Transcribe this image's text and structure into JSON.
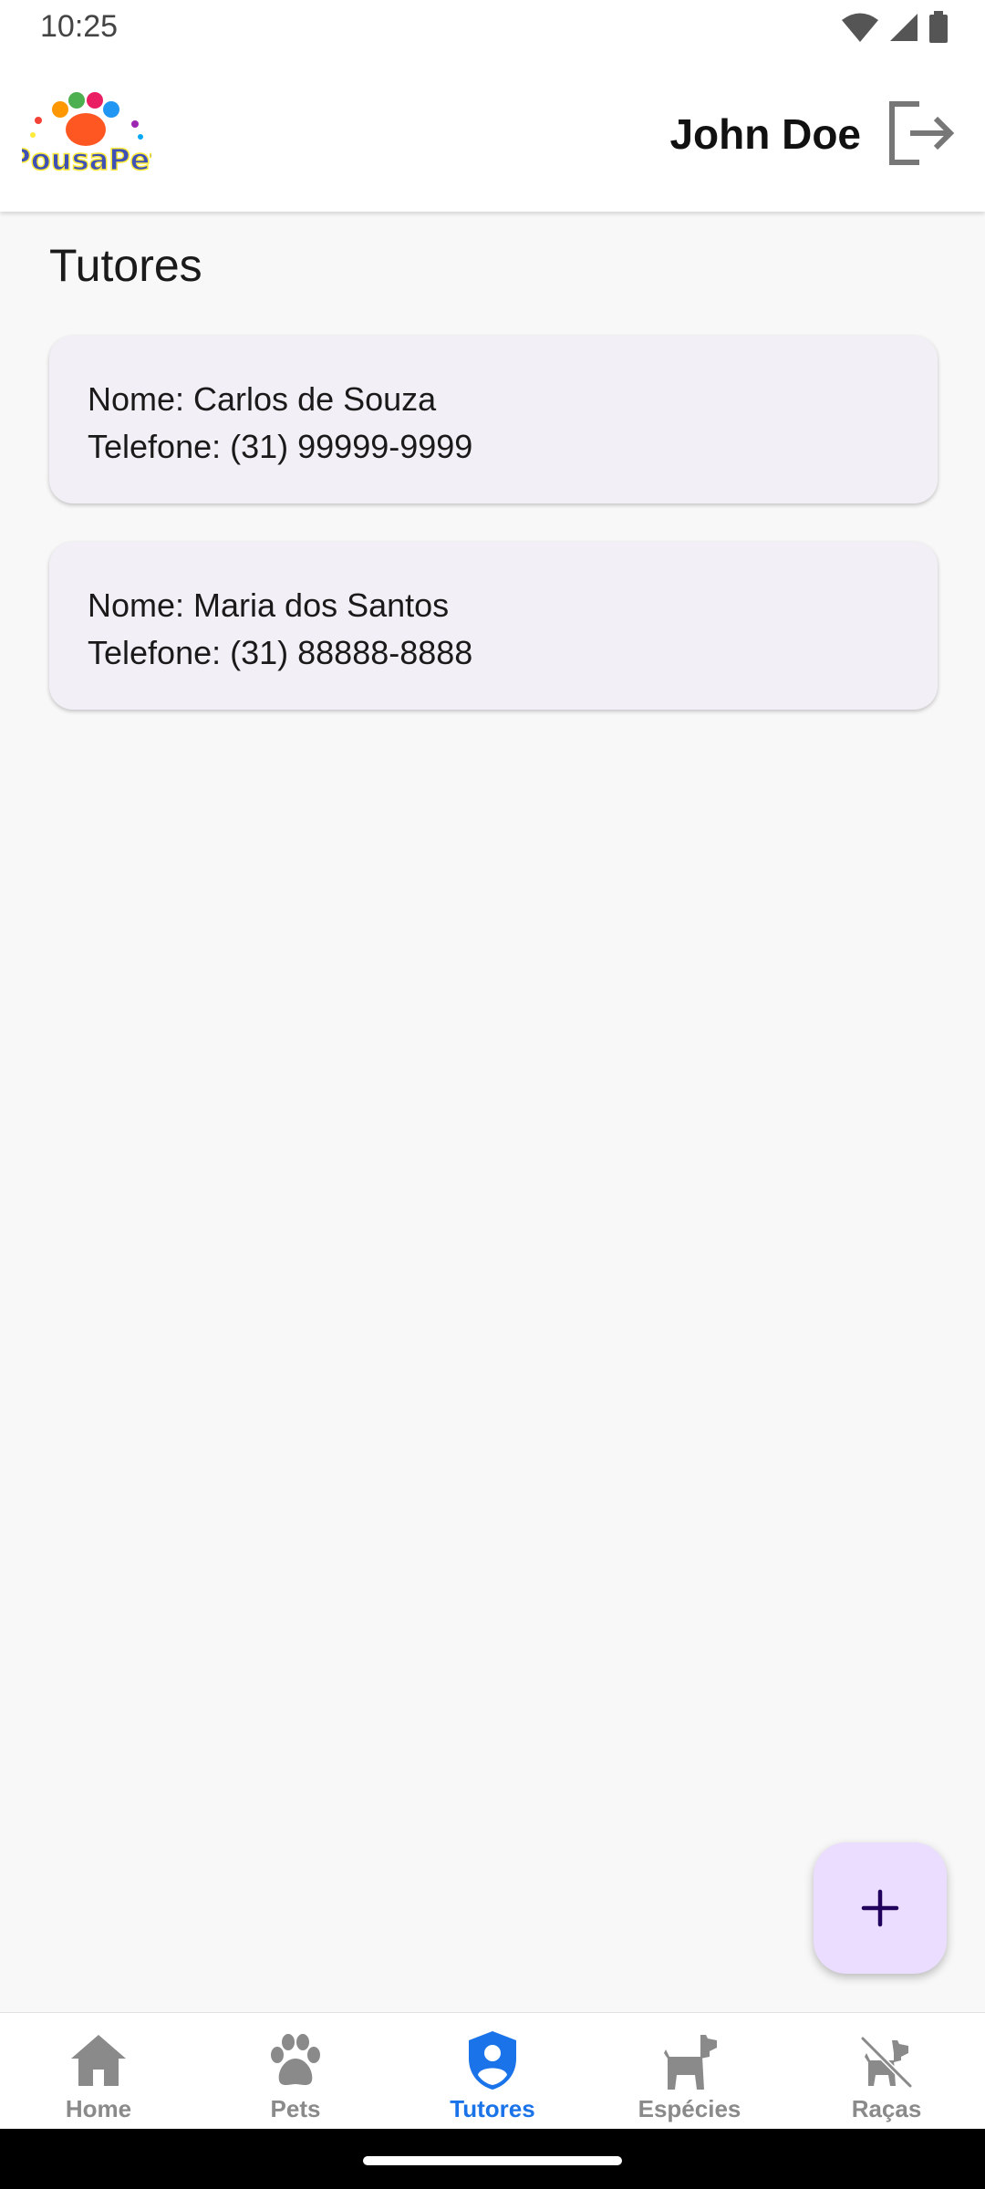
{
  "status_bar": {
    "time": "10:25",
    "icons": [
      "wifi-icon",
      "signal-icon",
      "battery-icon"
    ]
  },
  "header": {
    "logo_text": "PousaPet",
    "user_name": "John Doe",
    "logout_icon": "logout-icon"
  },
  "page": {
    "title": "Tutores"
  },
  "tutors": [
    {
      "name": "Nome: Carlos de Souza",
      "phone": "Telefone: (31) 99999-9999"
    },
    {
      "name": "Nome: Maria dos Santos",
      "phone": "Telefone: (31) 88888-8888"
    }
  ],
  "fab": {
    "icon": "plus-icon"
  },
  "bottom_nav": {
    "active_index": 2,
    "items": [
      {
        "label": "Home",
        "icon": "home-icon"
      },
      {
        "label": "Pets",
        "icon": "paw-icon"
      },
      {
        "label": "Tutores",
        "icon": "user-shield-icon"
      },
      {
        "label": "Espécies",
        "icon": "dog-icon"
      },
      {
        "label": "Raças",
        "icon": "dog-crossed-icon"
      }
    ]
  },
  "colors": {
    "accent": "#1a73e8",
    "inactive": "#8a8a8a",
    "card_bg": "#f3eff6",
    "fab_bg": "#eaddff"
  }
}
